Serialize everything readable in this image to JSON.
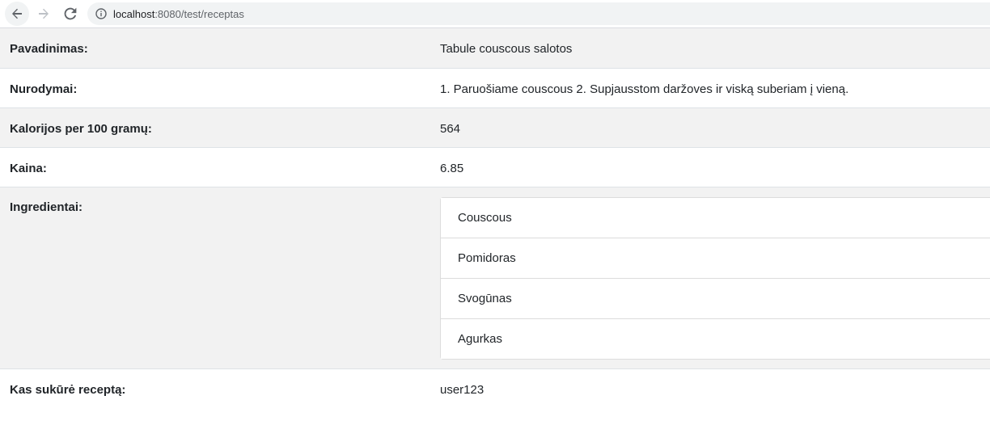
{
  "browser": {
    "url_host": "localhost",
    "url_rest": ":8080/test/receptas"
  },
  "recipe": {
    "name_label": "Pavadinimas:",
    "name_value": "Tabule couscous salotos",
    "instructions_label": "Nurodymai:",
    "instructions_value": "1. Paruošiame couscous 2. Supjausstom daržoves ir viską suberiam į vieną.",
    "calories_label": "Kalorijos per 100 gramų:",
    "calories_value": "564",
    "price_label": "Kaina:",
    "price_value": "6.85",
    "ingredients_label": "Ingredientai:",
    "ingredients": [
      "Couscous",
      "Pomidoras",
      "Svogūnas",
      "Agurkas"
    ],
    "author_label": "Kas sukūrė receptą:",
    "author_value": "user123"
  }
}
